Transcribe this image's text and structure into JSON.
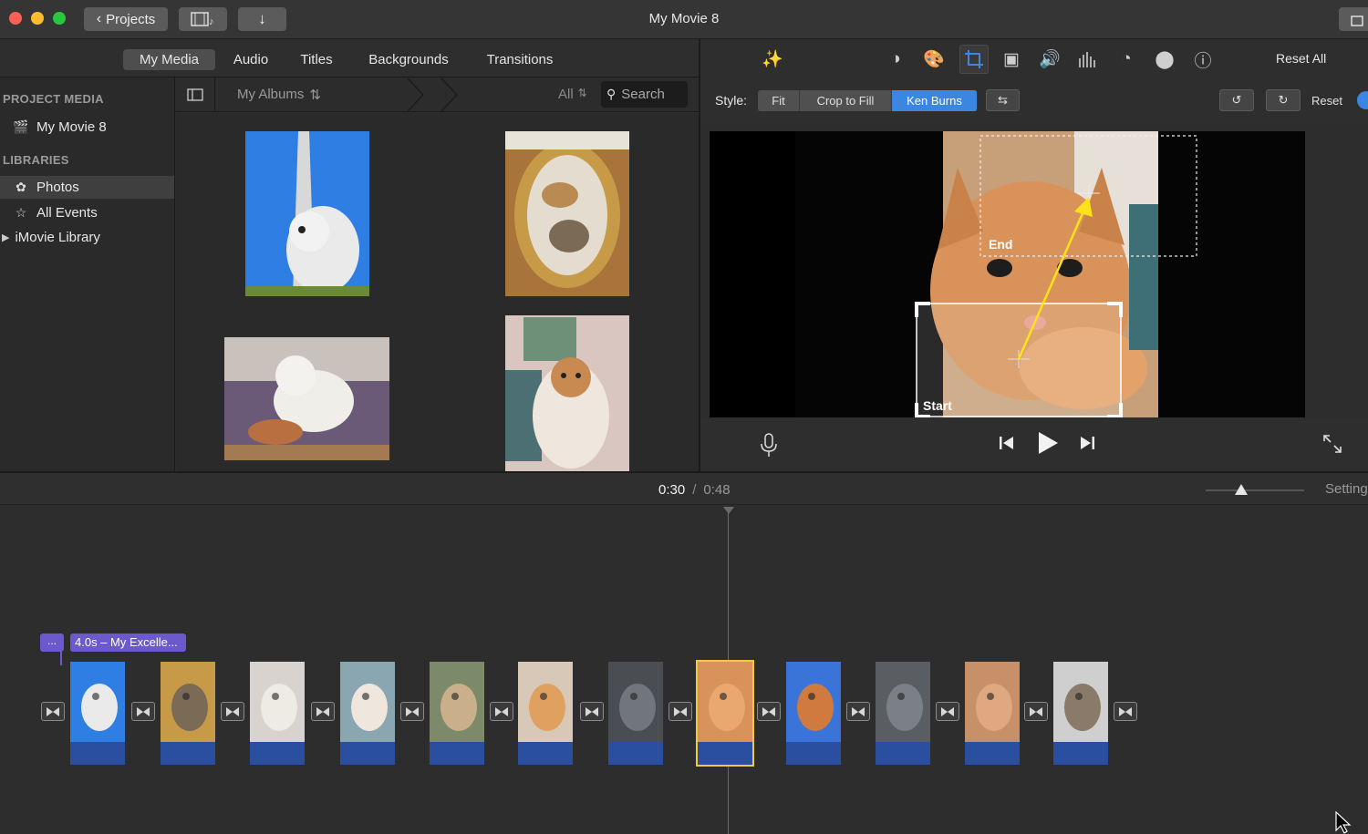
{
  "window": {
    "title": "My Movie 8"
  },
  "toolbar": {
    "projects_label": "Projects",
    "import_icon": "down-arrow-icon"
  },
  "browser": {
    "tabs": [
      "My Media",
      "Audio",
      "Titles",
      "Backgrounds",
      "Transitions"
    ],
    "active_tab": "My Media"
  },
  "sidebar": {
    "project_media_header": "PROJECT MEDIA",
    "project_item": "My Movie 8",
    "libraries_header": "LIBRARIES",
    "items": [
      "Photos",
      "All Events",
      "iMovie Library"
    ],
    "selected": "Photos"
  },
  "albums": {
    "label": "My Albums",
    "filter": "All",
    "search_placeholder": "Search"
  },
  "viewer": {
    "reset_all": "Reset All",
    "style_label": "Style:",
    "styles": [
      "Fit",
      "Crop to Fill",
      "Ken Burns"
    ],
    "active_style": "Ken Burns",
    "reset_label": "Reset",
    "end_label": "End",
    "start_label": "Start"
  },
  "timeline": {
    "current_time": "0:30",
    "separator": "/",
    "total_time": "0:48",
    "settings_label": "Settings",
    "title_badge": "...",
    "title_clip": "4.0s – My Excelle..."
  },
  "colors": {
    "accent": "#3b86e0",
    "selection": "#f2c744",
    "clip_bar": "#2b4fa0",
    "title_clip": "#6a5acd"
  }
}
